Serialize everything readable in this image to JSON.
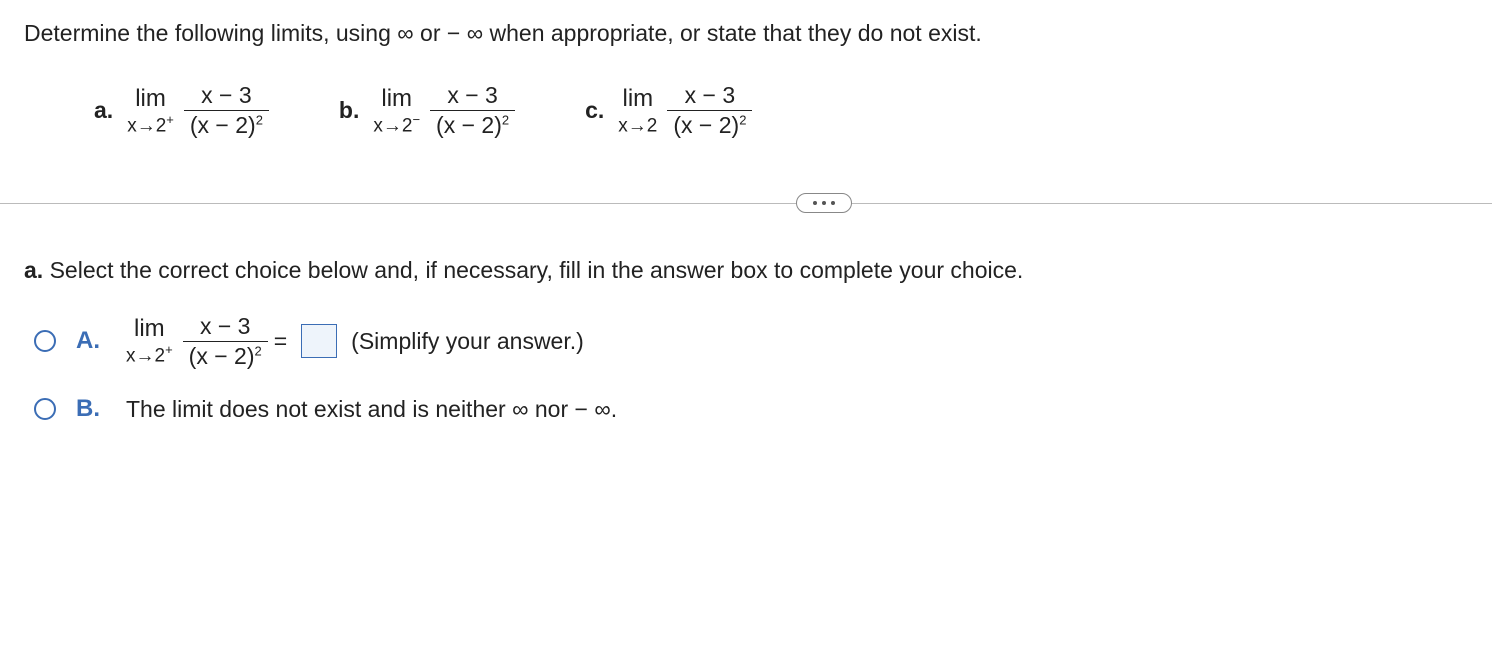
{
  "question": {
    "prompt": "Determine the following limits, using ∞ or − ∞ when appropriate, or state that they do not exist.",
    "parts": [
      {
        "label": "a.",
        "lim_word": "lim",
        "approach_var": "x→2",
        "approach_side": "+",
        "numerator": "x − 3",
        "den_base": "(x − 2)",
        "den_exp": "2"
      },
      {
        "label": "b.",
        "lim_word": "lim",
        "approach_var": "x→2",
        "approach_side": "−",
        "numerator": "x − 3",
        "den_base": "(x − 2)",
        "den_exp": "2"
      },
      {
        "label": "c.",
        "lim_word": "lim",
        "approach_var": "x→2",
        "approach_side": "",
        "numerator": "x − 3",
        "den_base": "(x − 2)",
        "den_exp": "2"
      }
    ]
  },
  "subquestion": {
    "label": "a.",
    "text": "Select the correct choice below and, if necessary, fill in the answer box to complete your choice."
  },
  "choices": {
    "A": {
      "label": "A.",
      "lim_word": "lim",
      "approach_var": "x→2",
      "approach_side": "+",
      "numerator": "x − 3",
      "den_base": "(x − 2)",
      "den_exp": "2",
      "equals": "=",
      "hint": "(Simplify your answer.)"
    },
    "B": {
      "label": "B.",
      "text": "The limit does not exist and is neither ∞ nor − ∞."
    }
  }
}
